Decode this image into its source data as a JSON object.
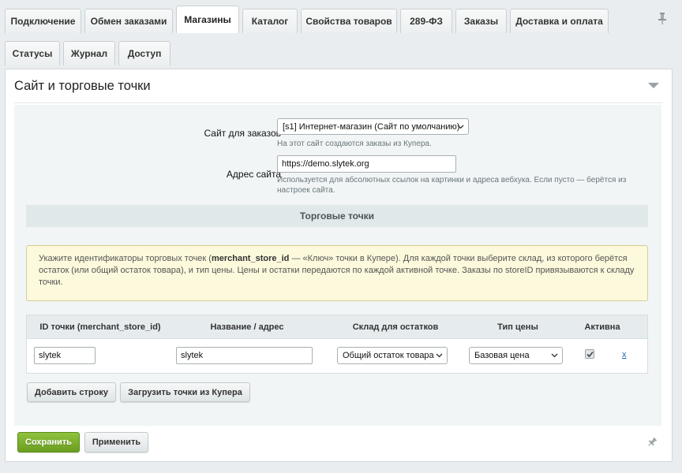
{
  "tabs_row1": [
    {
      "label": "Подключение",
      "active": false
    },
    {
      "label": "Обмен заказами",
      "active": false
    },
    {
      "label": "Магазины",
      "active": true
    },
    {
      "label": "Каталог",
      "active": false
    },
    {
      "label": "Свойства товаров",
      "active": false
    },
    {
      "label": "289-ФЗ",
      "active": false
    },
    {
      "label": "Заказы",
      "active": false
    },
    {
      "label": "Доставка и оплата",
      "active": false
    }
  ],
  "tabs_row2": [
    {
      "label": "Статусы"
    },
    {
      "label": "Журнал"
    },
    {
      "label": "Доступ"
    }
  ],
  "section": {
    "title": "Сайт и торговые точки",
    "collapse_icon": "triangle-down-icon"
  },
  "site": {
    "label": "Сайт для заказов",
    "value": "[s1] Интернет-магазин (Сайт по умолчанию)",
    "hint": "На этот сайт создаются заказы из Купера."
  },
  "address": {
    "label": "Адрес сайта",
    "value": "https://demo.slytek.org",
    "hint": "Используется для абсолютных ссылок на картинки и адреса вебхука. Если пусто — берётся из настроек сайта."
  },
  "stores": {
    "subheader": "Торговые точки",
    "notice_prefix": "Укажите идентификаторы торговых точек (",
    "notice_bold": "merchant_store_id",
    "notice_rest": " — «Ключ» точки в Купере). Для каждой точки выберите склад, из которого берётся остаток (или общий остаток товара), и тип цены. Цены и остатки передаются по каждой активной точке. Заказы по storeID привязываются к складу точки.",
    "columns": [
      "ID точки (merchant_store_id)",
      "Название / адрес",
      "Склад для остатков",
      "Тип цены",
      "Активна"
    ],
    "rows": [
      {
        "store_id": "slytek",
        "name": "slytek",
        "warehouse": "Общий остаток товара",
        "price_type": "Базовая цена",
        "active": true,
        "delete_label": "x"
      }
    ],
    "add_row_label": "Добавить строку",
    "load_label": "Загрузить точки из Купера"
  },
  "footer": {
    "save_label": "Сохранить",
    "apply_label": "Применить"
  },
  "colors": {
    "primary_button": "#7cb02c",
    "link": "#2067b0",
    "notice_bg": "#fcf9dc",
    "page_bg": "#e9edef"
  }
}
